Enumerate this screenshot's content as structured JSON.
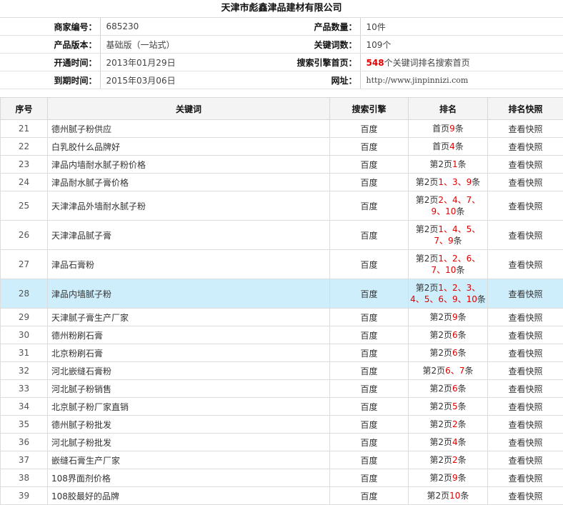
{
  "title": "天津市彪鑫津品建材有限公司",
  "info": {
    "left": [
      {
        "label": "商家编号：",
        "value": "685230"
      },
      {
        "label": "产品版本：",
        "value": "基础版（一站式）"
      },
      {
        "label": "开通时间：",
        "value": "2013年01月29日"
      },
      {
        "label": "到期时间：",
        "value": "2015年03月06日"
      }
    ],
    "right": [
      {
        "label": "产品数量：",
        "value": "10件"
      },
      {
        "label": "关键词数：",
        "value": "109个"
      },
      {
        "label": "搜索引擎首页：",
        "value_red": "548",
        "value": "个关键词排名搜索首页"
      },
      {
        "label": "网址：",
        "value": "http://www.jinpinnizi.com"
      }
    ]
  },
  "table": {
    "headers": [
      "序号",
      "关键词",
      "搜索引擎",
      "排名",
      "排名快照"
    ],
    "rows": [
      {
        "idx": "21",
        "keyword": "德州腻子粉供应",
        "engine": "百度",
        "rank_prefix": "首页",
        "rank_nums": "9",
        "rank_nums2": "",
        "rank_suffix": "条",
        "snapshot": "查看快照",
        "height": 25
      },
      {
        "idx": "22",
        "keyword": "白乳胶什么品牌好",
        "engine": "百度",
        "rank_prefix": "首页",
        "rank_nums": "4",
        "rank_nums2": "",
        "rank_suffix": "条",
        "snapshot": "查看快照",
        "height": 25
      },
      {
        "idx": "23",
        "keyword": "津品内墙耐水腻子粉价格",
        "engine": "百度",
        "rank_prefix": "第2页",
        "rank_nums": "1",
        "rank_nums2": "",
        "rank_suffix": "条",
        "snapshot": "查看快照",
        "height": 25
      },
      {
        "idx": "24",
        "keyword": "津品耐水腻子膏价格",
        "engine": "百度",
        "rank_prefix": "第2页",
        "rank_nums": "1、3、9",
        "rank_nums2": "",
        "rank_suffix": "条",
        "snapshot": "查看快照",
        "height": 25
      },
      {
        "idx": "25",
        "keyword": "天津津品外墙耐水腻子粉",
        "engine": "百度",
        "rank_prefix": "第2页",
        "rank_nums": "2、4、7、",
        "rank_nums2": "9、10",
        "rank_suffix": "条",
        "snapshot": "查看快照",
        "height": 41
      },
      {
        "idx": "26",
        "keyword": "天津津品腻子膏",
        "engine": "百度",
        "rank_prefix": "第2页",
        "rank_nums": "1、4、5、",
        "rank_nums2": "7、9",
        "rank_suffix": "条",
        "snapshot": "查看快照",
        "height": 41
      },
      {
        "idx": "27",
        "keyword": "津品石膏粉",
        "engine": "百度",
        "rank_prefix": "第2页",
        "rank_nums": "1、2、6、",
        "rank_nums2": "7、10",
        "rank_suffix": "条",
        "snapshot": "查看快照",
        "height": 41
      },
      {
        "idx": "28",
        "keyword": "津品内墙腻子粉",
        "engine": "百度",
        "rank_prefix": "第2页",
        "rank_nums": "1、2、3、",
        "rank_nums2": "4、5、6、9、10",
        "rank_suffix": "条",
        "snapshot": "查看快照",
        "height": 41,
        "highlight": true
      },
      {
        "idx": "29",
        "keyword": "天津腻子膏生产厂家",
        "engine": "百度",
        "rank_prefix": "第2页",
        "rank_nums": "9",
        "rank_nums2": "",
        "rank_suffix": "条",
        "snapshot": "查看快照",
        "height": 25
      },
      {
        "idx": "30",
        "keyword": "德州粉刷石膏",
        "engine": "百度",
        "rank_prefix": "第2页",
        "rank_nums": "6",
        "rank_nums2": "",
        "rank_suffix": "条",
        "snapshot": "查看快照",
        "height": 25
      },
      {
        "idx": "31",
        "keyword": "北京粉刷石膏",
        "engine": "百度",
        "rank_prefix": "第2页",
        "rank_nums": "6",
        "rank_nums2": "",
        "rank_suffix": "条",
        "snapshot": "查看快照",
        "height": 25
      },
      {
        "idx": "32",
        "keyword": "河北嵌缝石膏粉",
        "engine": "百度",
        "rank_prefix": "第2页",
        "rank_nums": "6、7",
        "rank_nums2": "",
        "rank_suffix": "条",
        "snapshot": "查看快照",
        "height": 25
      },
      {
        "idx": "33",
        "keyword": "河北腻子粉销售",
        "engine": "百度",
        "rank_prefix": "第2页",
        "rank_nums": "6",
        "rank_nums2": "",
        "rank_suffix": "条",
        "snapshot": "查看快照",
        "height": 25
      },
      {
        "idx": "34",
        "keyword": "北京腻子粉厂家直销",
        "engine": "百度",
        "rank_prefix": "第2页",
        "rank_nums": "5",
        "rank_nums2": "",
        "rank_suffix": "条",
        "snapshot": "查看快照",
        "height": 25
      },
      {
        "idx": "35",
        "keyword": "德州腻子粉批发",
        "engine": "百度",
        "rank_prefix": "第2页",
        "rank_nums": "2",
        "rank_nums2": "",
        "rank_suffix": "条",
        "snapshot": "查看快照",
        "height": 25
      },
      {
        "idx": "36",
        "keyword": "河北腻子粉批发",
        "engine": "百度",
        "rank_prefix": "第2页",
        "rank_nums": "4",
        "rank_nums2": "",
        "rank_suffix": "条",
        "snapshot": "查看快照",
        "height": 25
      },
      {
        "idx": "37",
        "keyword": "嵌缝石膏生产厂家",
        "engine": "百度",
        "rank_prefix": "第2页",
        "rank_nums": "2",
        "rank_nums2": "",
        "rank_suffix": "条",
        "snapshot": "查看快照",
        "height": 25
      },
      {
        "idx": "38",
        "keyword": "108界面剂价格",
        "engine": "百度",
        "rank_prefix": "第2页",
        "rank_nums": "9",
        "rank_nums2": "",
        "rank_suffix": "条",
        "snapshot": "查看快照",
        "height": 25
      },
      {
        "idx": "39",
        "keyword": "108胶最好的品牌",
        "engine": "百度",
        "rank_prefix": "第2页",
        "rank_nums": "10",
        "rank_nums2": "",
        "rank_suffix": "条",
        "snapshot": "查看快照",
        "height": 25
      }
    ]
  }
}
